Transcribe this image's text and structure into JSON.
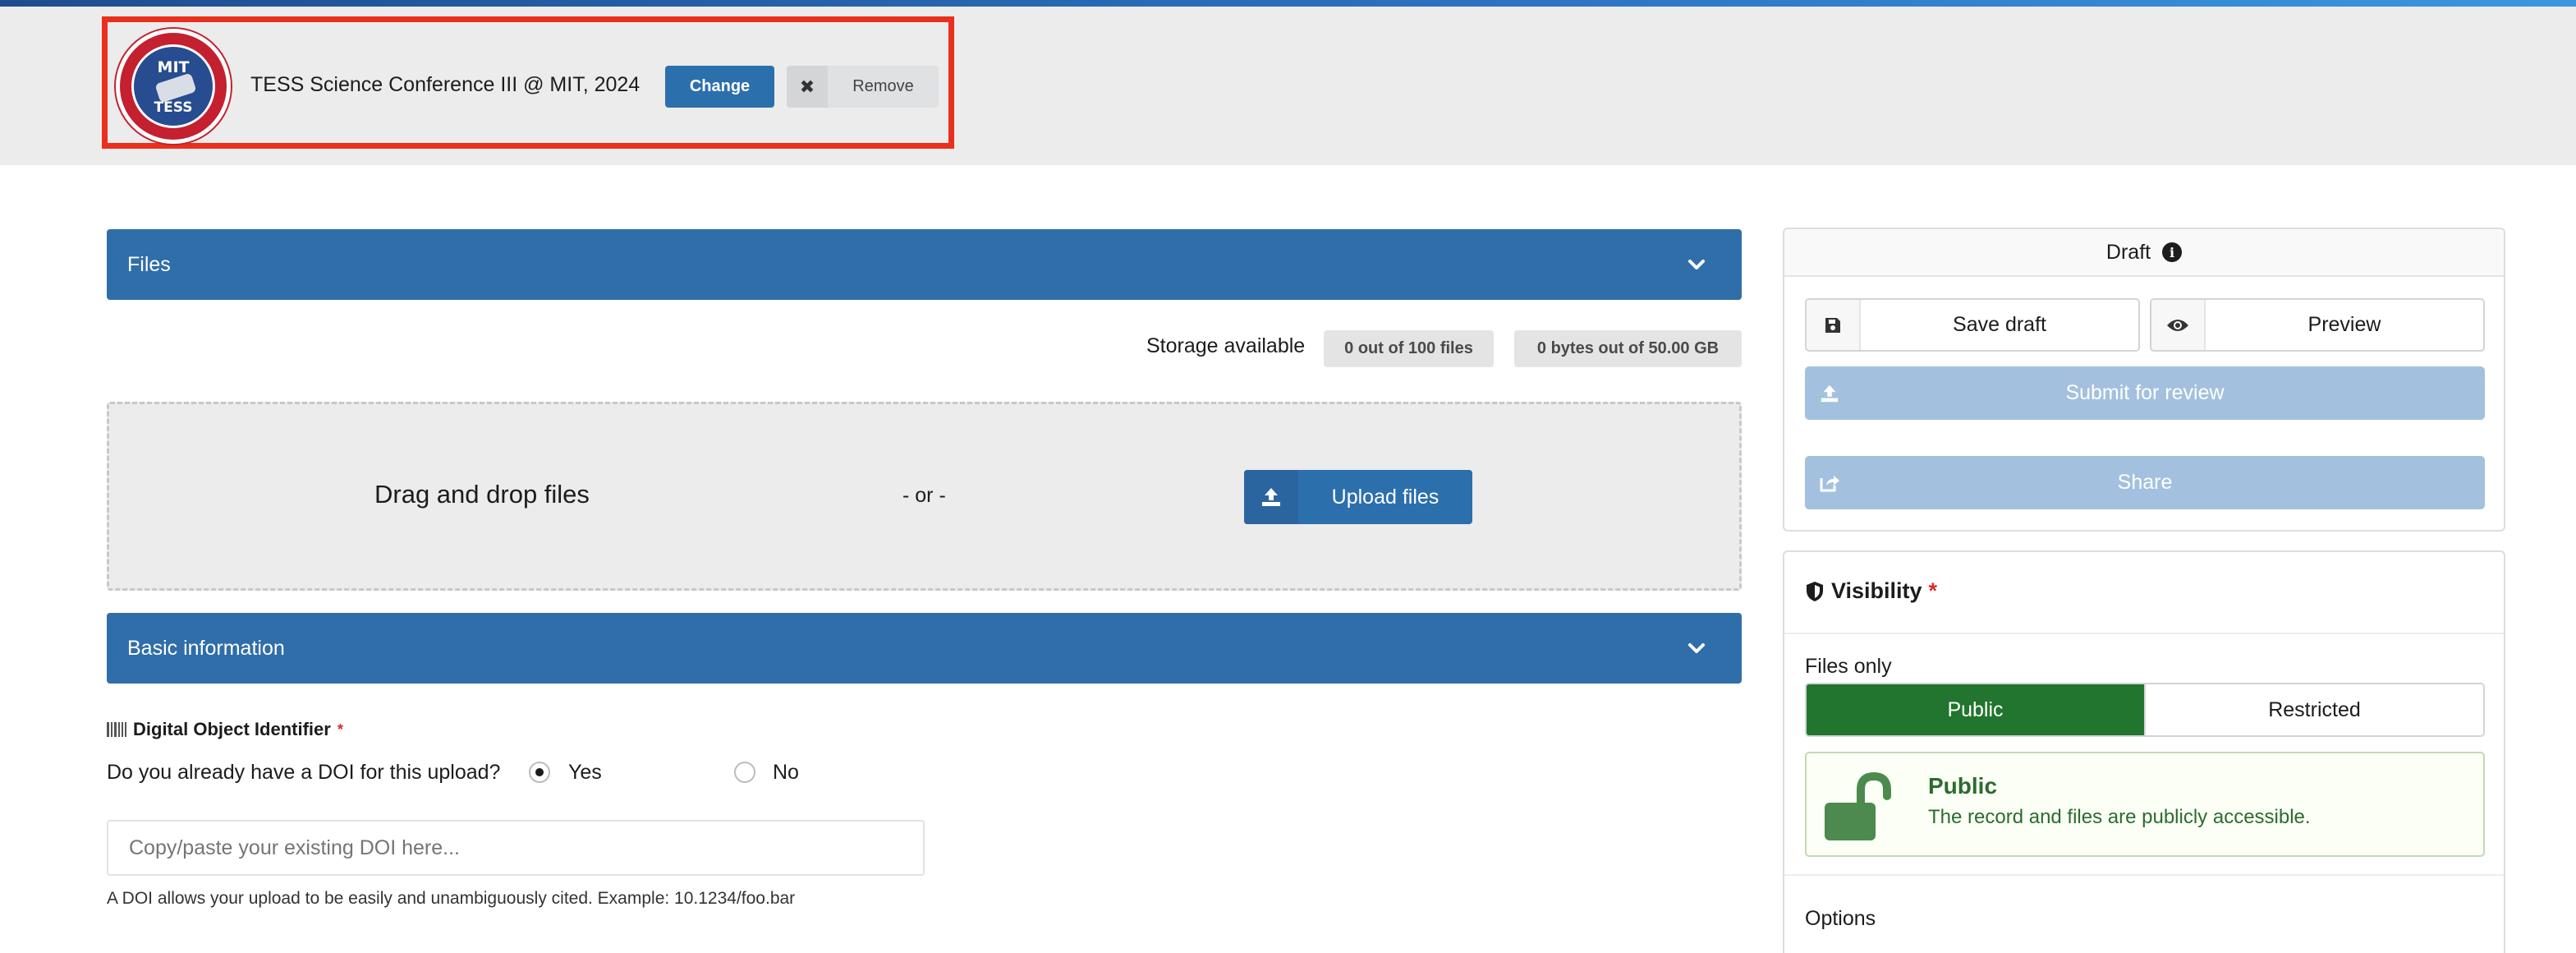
{
  "header": {
    "community_title": "TESS Science Conference III @ MIT, 2024",
    "logo_text_top": "MIT",
    "logo_text_bottom": "TESS",
    "change_label": "Change",
    "remove_label": "Remove"
  },
  "files_section": {
    "title": "Files",
    "storage_label": "Storage available",
    "files_quota": "0 out of 100 files",
    "bytes_quota": "0 bytes out of 50.00 GB",
    "drag_drop_label": "Drag and drop files",
    "or_label": "- or -",
    "upload_label": "Upload files"
  },
  "basic_info": {
    "title": "Basic information",
    "doi_label": "Digital Object Identifier",
    "required_marker": "*",
    "doi_question": "Do you already have a DOI for this upload?",
    "yes_label": "Yes",
    "no_label": "No",
    "selected_option": "Yes",
    "doi_placeholder": "Copy/paste your existing DOI here...",
    "doi_value": "",
    "doi_help": "A DOI allows your upload to be easily and unambiguously cited. Example: 10.1234/foo.bar"
  },
  "draft_panel": {
    "status": "Draft",
    "save_draft_label": "Save draft",
    "preview_label": "Preview",
    "submit_label": "Submit for review",
    "share_label": "Share"
  },
  "visibility": {
    "title": "Visibility",
    "required_marker": "*",
    "files_only_label": "Files only",
    "public_label": "Public",
    "restricted_label": "Restricted",
    "selected": "Public",
    "message_title": "Public",
    "message_text": "The record and files are publicly accessible.",
    "options_label": "Options"
  },
  "colors": {
    "primary": "#2f6ea9",
    "accent_green": "#21752e",
    "highlight_border": "#e8301c",
    "disabled_primary": "#a3c1de"
  },
  "icons": [
    "chevron-down-icon",
    "close-icon",
    "upload-icon",
    "barcode-icon",
    "info-icon",
    "save-icon",
    "eye-icon",
    "share-icon",
    "shield-icon",
    "unlock-icon"
  ]
}
